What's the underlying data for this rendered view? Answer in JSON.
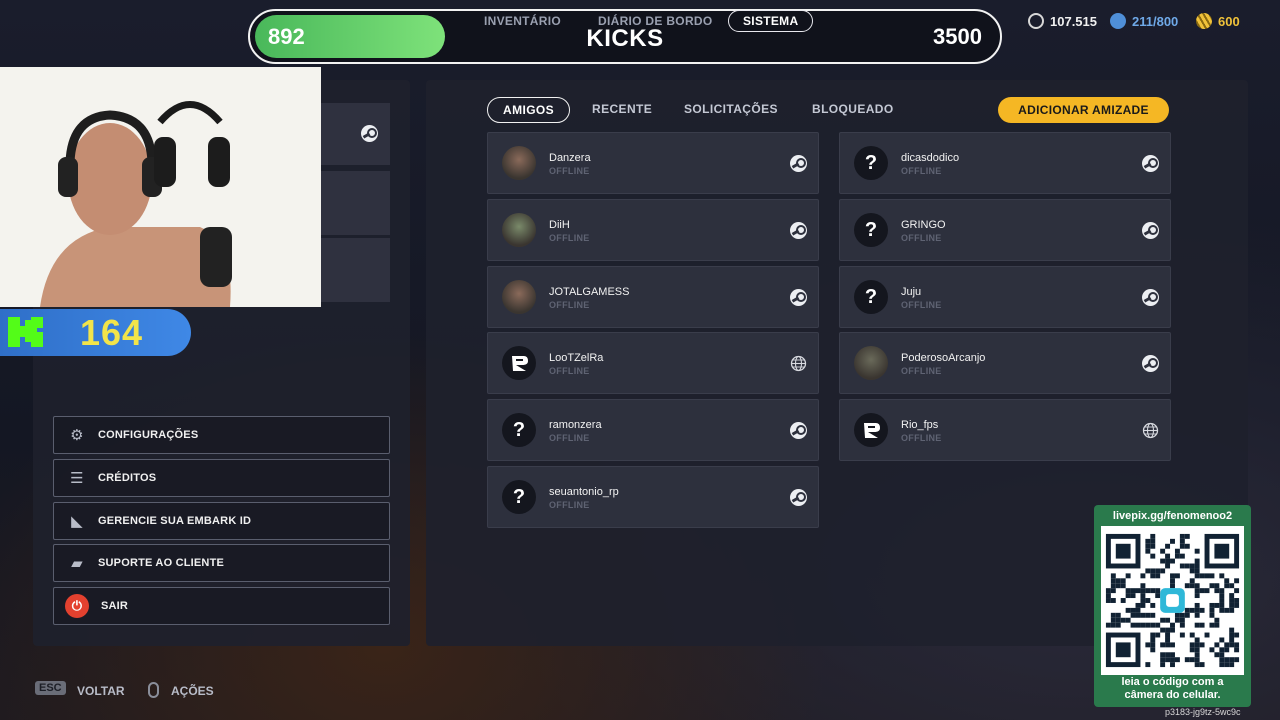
{
  "topbar": {
    "xp_current": "892",
    "xp_max": "3500",
    "xp_progress": 0.255,
    "title": "KICKS",
    "tabs": [
      "INVENTÁRIO",
      "DIÁRIO DE BORDO",
      "SISTEMA"
    ],
    "active_tab": "SISTEMA"
  },
  "currencies": [
    {
      "value": "107.515",
      "icon": "coin-icon"
    },
    {
      "value": "211/800",
      "icon": "bond-icon"
    },
    {
      "value": "600",
      "icon": "gold-icon"
    }
  ],
  "overlay": {
    "kick_count": "164"
  },
  "menu": {
    "settings": "CONFIGURAÇÕES",
    "credits": "CRÉDITOS",
    "embark": "GERENCIE SUA EMBARK ID",
    "support": "SUPORTE AO CLIENTE",
    "exit": "SAIR"
  },
  "friends_tabs": {
    "friends": "AMIGOS",
    "recent": "RECENTE",
    "requests": "SOLICITAÇÕES",
    "blocked": "BLOQUEADO",
    "add_friend": "ADICIONAR AMIZADE"
  },
  "friends": [
    {
      "name": "Danzera",
      "status": "OFFLINE",
      "platform": "steam",
      "avatar": "photo"
    },
    {
      "name": "dicasdodico",
      "status": "OFFLINE",
      "platform": "steam",
      "avatar": "unknown"
    },
    {
      "name": "DiiH",
      "status": "OFFLINE",
      "platform": "steam",
      "avatar": "photo"
    },
    {
      "name": "GRINGO",
      "status": "OFFLINE",
      "platform": "steam",
      "avatar": "unknown"
    },
    {
      "name": "JOTALGAMESS",
      "status": "OFFLINE",
      "platform": "steam",
      "avatar": "photo"
    },
    {
      "name": "Juju",
      "status": "OFFLINE",
      "platform": "steam",
      "avatar": "unknown"
    },
    {
      "name": "LooTZelRa",
      "status": "OFFLINE",
      "platform": "web",
      "avatar": "embark"
    },
    {
      "name": "PoderosoArcanjo",
      "status": "OFFLINE",
      "platform": "steam",
      "avatar": "photo"
    },
    {
      "name": "ramonzera",
      "status": "OFFLINE",
      "platform": "steam",
      "avatar": "unknown"
    },
    {
      "name": "Rio_fps",
      "status": "OFFLINE",
      "platform": "web",
      "avatar": "embark"
    },
    {
      "name": "seuantonio_rp",
      "status": "OFFLINE",
      "platform": "steam",
      "avatar": "unknown"
    }
  ],
  "hints": {
    "esc_key": "ESC",
    "back": "VOLTAR",
    "actions": "AÇÕES"
  },
  "qr": {
    "url": "livepix.gg/fenomenoo2",
    "caption_line1": "leia o código com a",
    "caption_line2": "câmera do celular."
  },
  "footer_code": "p3183-jg9tz-5wc9c",
  "colors": {
    "accent": "#f5b724",
    "xp_bar": "#5fcb68",
    "kick_badge": "#3a80dc",
    "kick_text": "#f2e44a",
    "qr_bg": "#2a7a4c",
    "exit_icon": "#e3412f"
  }
}
